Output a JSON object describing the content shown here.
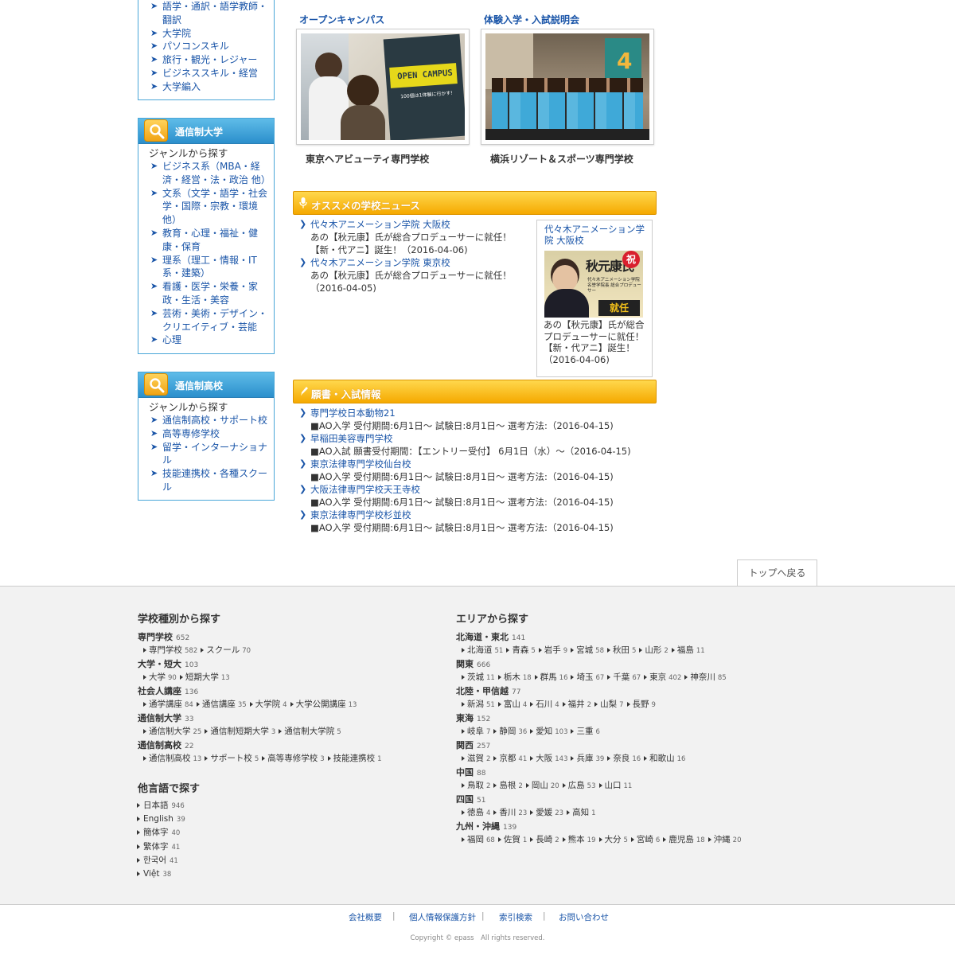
{
  "sidebar": {
    "box1_items": [
      "語学・通訳・語学教師・翻訳",
      "大学院",
      "パソコンスキル",
      "旅行・観光・レジャー",
      "ビジネススキル・経営",
      "大学編入"
    ],
    "box2": {
      "title": "通信制大学",
      "sub": "ジャンルから探す",
      "items": [
        "ビジネス系（MBA・経済・経営・法・政治 他）",
        "文系（文学・語学・社会学・国際・宗教・環境 他）",
        "教育・心理・福祉・健康・保育",
        "理系（理工・情報・IT系・建築）",
        "看護・医学・栄養・家政・生活・美容",
        "芸術・美術・デザイン・クリエイティブ・芸能",
        "心理"
      ]
    },
    "box3": {
      "title": "通信制高校",
      "sub": "ジャンルから探す",
      "items": [
        "通信制高校・サポート校",
        "高等専修学校",
        "留学・インターナショナル",
        "技能連携校・各種スクール"
      ]
    }
  },
  "events": {
    "left": {
      "heading": "オープンキャンパス",
      "school": "東京ヘアビューティ専門学校",
      "img_text1": "OPEN CAMPUS",
      "img_text2": "100個は1体験に行かす!"
    },
    "right": {
      "heading": "体験入学・入試説明会",
      "school": "横浜リゾート＆スポーツ専門学校"
    }
  },
  "news": {
    "title": "オススメの学校ニュース",
    "items": [
      {
        "school": "代々木アニメーション学院 大阪校",
        "desc": "あの【秋元康】氏が総合プロデューサーに就任！【新・代アニ】誕生！（2016-04-06)"
      },
      {
        "school": "代々木アニメーション学院 東京校",
        "desc": "あの【秋元康】氏が総合プロデューサーに就任！（2016-04-05)"
      }
    ],
    "feature": {
      "school": "代々木アニメーション学院 大阪校",
      "desc": "あの【秋元康】氏が総合プロデューサーに就任！【新・代アニ】誕生！（2016-04-06)",
      "img_name": "秋元康氏",
      "img_badge": "祝",
      "img_caption": "代々木アニメーション学院 名誉学院長 総合プロデューサー",
      "img_ribbon": "就任"
    }
  },
  "admission": {
    "title": "願書・入試情報",
    "items": [
      {
        "school": "専門学校日本動物21",
        "desc": "■AO入学 受付期間:6月1日～ 試験日:8月1日～ 選考方法:（2016-04-15)"
      },
      {
        "school": "早稲田美容専門学校",
        "desc": "■AO入試 願書受付期間：【エントリー受付】 6月1日（水）～（2016-04-15)"
      },
      {
        "school": "東京法律専門学校仙台校",
        "desc": "■AO入学 受付期間:6月1日～ 試験日:8月1日～ 選考方法:（2016-04-15)"
      },
      {
        "school": "大阪法律専門学校天王寺校",
        "desc": "■AO入学 受付期間:6月1日～ 試験日:8月1日～ 選考方法:（2016-04-15)"
      },
      {
        "school": "東京法律専門学校杉並校",
        "desc": "■AO入学 受付期間:6月1日～ 試験日:8月1日～ 選考方法:（2016-04-15)"
      }
    ]
  },
  "top_button": "トップへ戻る",
  "footer": {
    "type_heading": "学校種別から探す",
    "types": [
      {
        "name": "専門学校",
        "count": "652",
        "subs": [
          [
            "専門学校",
            "582"
          ],
          [
            "スクール",
            "70"
          ]
        ]
      },
      {
        "name": "大学・短大",
        "count": "103",
        "subs": [
          [
            "大学",
            "90"
          ],
          [
            "短期大学",
            "13"
          ]
        ]
      },
      {
        "name": "社会人講座",
        "count": "136",
        "subs": [
          [
            "通学講座",
            "84"
          ],
          [
            "通信講座",
            "35"
          ],
          [
            "大学院",
            "4"
          ],
          [
            "大学公開講座",
            "13"
          ]
        ]
      },
      {
        "name": "通信制大学",
        "count": "33",
        "subs": [
          [
            "通信制大学",
            "25"
          ],
          [
            "通信制短期大学",
            "3"
          ],
          [
            "通信制大学院",
            "5"
          ]
        ]
      },
      {
        "name": "通信制高校",
        "count": "22",
        "subs": [
          [
            "通信制高校",
            "13"
          ],
          [
            "サポート校",
            "5"
          ],
          [
            "高等専修学校",
            "3"
          ],
          [
            "技能連携校",
            "1"
          ]
        ]
      }
    ],
    "lang_heading": "他言語で探す",
    "langs": [
      [
        "日本語",
        "946"
      ],
      [
        "English",
        "39"
      ],
      [
        "簡体字",
        "40"
      ],
      [
        "繁体字",
        "41"
      ],
      [
        "한국어",
        "41"
      ],
      [
        "Việt",
        "38"
      ]
    ],
    "area_heading": "エリアから探す",
    "areas": [
      {
        "name": "北海道・東北",
        "count": "141",
        "subs": [
          [
            "北海道",
            "51"
          ],
          [
            "青森",
            "5"
          ],
          [
            "岩手",
            "9"
          ],
          [
            "宮城",
            "58"
          ],
          [
            "秋田",
            "5"
          ],
          [
            "山形",
            "2"
          ],
          [
            "福島",
            "11"
          ]
        ]
      },
      {
        "name": "関東",
        "count": "666",
        "subs": [
          [
            "茨城",
            "11"
          ],
          [
            "栃木",
            "18"
          ],
          [
            "群馬",
            "16"
          ],
          [
            "埼玉",
            "67"
          ],
          [
            "千葉",
            "67"
          ],
          [
            "東京",
            "402"
          ],
          [
            "神奈川",
            "85"
          ]
        ]
      },
      {
        "name": "北陸・甲信越",
        "count": "77",
        "subs": [
          [
            "新潟",
            "51"
          ],
          [
            "富山",
            "4"
          ],
          [
            "石川",
            "4"
          ],
          [
            "福井",
            "2"
          ],
          [
            "山梨",
            "7"
          ],
          [
            "長野",
            "9"
          ]
        ]
      },
      {
        "name": "東海",
        "count": "152",
        "subs": [
          [
            "岐阜",
            "7"
          ],
          [
            "静岡",
            "36"
          ],
          [
            "愛知",
            "103"
          ],
          [
            "三重",
            "6"
          ]
        ]
      },
      {
        "name": "関西",
        "count": "257",
        "subs": [
          [
            "滋賀",
            "2"
          ],
          [
            "京都",
            "41"
          ],
          [
            "大阪",
            "143"
          ],
          [
            "兵庫",
            "39"
          ],
          [
            "奈良",
            "16"
          ],
          [
            "和歌山",
            "16"
          ]
        ]
      },
      {
        "name": "中国",
        "count": "88",
        "subs": [
          [
            "鳥取",
            "2"
          ],
          [
            "島根",
            "2"
          ],
          [
            "岡山",
            "20"
          ],
          [
            "広島",
            "53"
          ],
          [
            "山口",
            "11"
          ]
        ]
      },
      {
        "name": "四国",
        "count": "51",
        "subs": [
          [
            "徳島",
            "4"
          ],
          [
            "香川",
            "23"
          ],
          [
            "愛媛",
            "23"
          ],
          [
            "高知",
            "1"
          ]
        ]
      },
      {
        "name": "九州・沖縄",
        "count": "139",
        "subs": [
          [
            "福岡",
            "68"
          ],
          [
            "佐賀",
            "1"
          ],
          [
            "長崎",
            "2"
          ],
          [
            "熊本",
            "19"
          ],
          [
            "大分",
            "5"
          ],
          [
            "宮崎",
            "6"
          ],
          [
            "鹿児島",
            "18"
          ],
          [
            "沖縄",
            "20"
          ]
        ]
      }
    ],
    "nav": [
      "会社概要",
      "個人情報保護方針",
      "索引検索",
      "お問い合わせ"
    ],
    "copyright": "Copyright © epass　All rights reserved."
  },
  "colors": {
    "link": "#1a55a8",
    "accent_blue": "#2b8fcc",
    "accent_orange": "#f5a900"
  }
}
